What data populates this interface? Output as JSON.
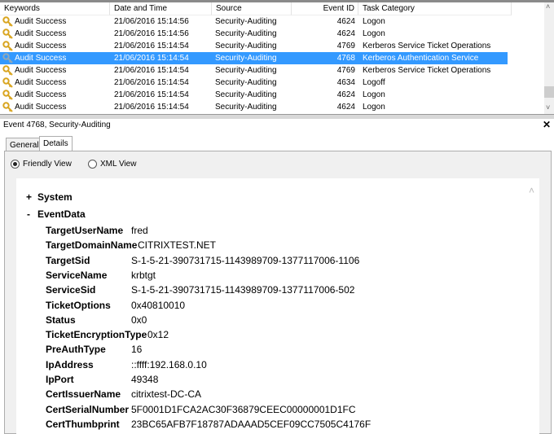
{
  "columns": [
    "Keywords",
    "Date and Time",
    "Source",
    "Event ID",
    "Task Category"
  ],
  "rows": [
    {
      "keyword": "Audit Success",
      "datetime": "21/06/2016 15:14:56",
      "source": "Security-Auditing",
      "event_id": "4624",
      "task": "Logon"
    },
    {
      "keyword": "Audit Success",
      "datetime": "21/06/2016 15:14:56",
      "source": "Security-Auditing",
      "event_id": "4624",
      "task": "Logon"
    },
    {
      "keyword": "Audit Success",
      "datetime": "21/06/2016 15:14:54",
      "source": "Security-Auditing",
      "event_id": "4769",
      "task": "Kerberos Service Ticket Operations"
    },
    {
      "keyword": "Audit Success",
      "datetime": "21/06/2016 15:14:54",
      "source": "Security-Auditing",
      "event_id": "4768",
      "task": "Kerberos Authentication Service",
      "selected": true
    },
    {
      "keyword": "Audit Success",
      "datetime": "21/06/2016 15:14:54",
      "source": "Security-Auditing",
      "event_id": "4769",
      "task": "Kerberos Service Ticket Operations"
    },
    {
      "keyword": "Audit Success",
      "datetime": "21/06/2016 15:14:54",
      "source": "Security-Auditing",
      "event_id": "4634",
      "task": "Logoff"
    },
    {
      "keyword": "Audit Success",
      "datetime": "21/06/2016 15:14:54",
      "source": "Security-Auditing",
      "event_id": "4624",
      "task": "Logon"
    },
    {
      "keyword": "Audit Success",
      "datetime": "21/06/2016 15:14:54",
      "source": "Security-Auditing",
      "event_id": "4624",
      "task": "Logon"
    }
  ],
  "event_title": "Event 4768, Security-Auditing",
  "close_label": "✕",
  "tabs": {
    "general": "General",
    "details": "Details"
  },
  "views": {
    "friendly": "Friendly View",
    "xml": "XML View"
  },
  "sections": {
    "system_toggle": "+",
    "system": "System",
    "eventdata_toggle": "-",
    "eventdata": "EventData"
  },
  "fields": [
    {
      "name": "TargetUserName",
      "value": "fred"
    },
    {
      "name": "TargetDomainName",
      "value": "CITRIXTEST.NET"
    },
    {
      "name": "TargetSid",
      "value": "S-1-5-21-390731715-1143989709-1377117006-1106"
    },
    {
      "name": "ServiceName",
      "value": "krbtgt"
    },
    {
      "name": "ServiceSid",
      "value": "S-1-5-21-390731715-1143989709-1377117006-502"
    },
    {
      "name": "TicketOptions",
      "value": "0x40810010"
    },
    {
      "name": "Status",
      "value": "0x0"
    },
    {
      "name": "TicketEncryptionType",
      "value": "0x12"
    },
    {
      "name": "PreAuthType",
      "value": "16"
    },
    {
      "name": "IpAddress",
      "value": "::ffff:192.168.0.10"
    },
    {
      "name": "IpPort",
      "value": "49348"
    },
    {
      "name": "CertIssuerName",
      "value": "citrixtest-DC-CA"
    },
    {
      "name": "CertSerialNumber",
      "value": "5F0001D1FCA2AC30F36879CEEC00000001D1FC"
    },
    {
      "name": "CertThumbprint",
      "value": "23BC65AFB7F18787ADAAAD5CEF09CC7505C4176F"
    }
  ],
  "colors": {
    "selection": "#3399ff",
    "key_icon": "#d9a520"
  }
}
